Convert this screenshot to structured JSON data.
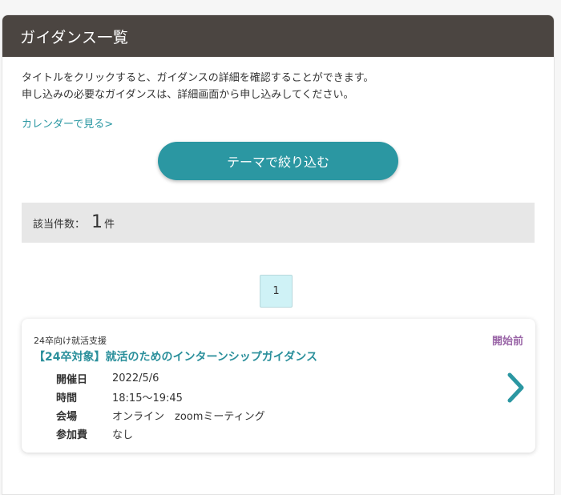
{
  "header": {
    "title": "ガイダンス一覧"
  },
  "description": {
    "line1": "タイトルをクリックすると、ガイダンスの詳細を確認することができます。",
    "line2": "申し込みの必要なガイダンスは、詳細画面から申し込みしてください。"
  },
  "calendar_link": "カレンダーで見る>",
  "theme_button": "テーマで絞り込む",
  "results": {
    "label": "該当件数：",
    "count": "1",
    "unit": "件"
  },
  "pagination": {
    "current_page": "1"
  },
  "guidance": {
    "category": "24卒向け就活支援",
    "status": "開始前",
    "title": "【24卒対象】就活のためのインターンシップガイダンス",
    "rows": [
      {
        "label": "開催日",
        "value": "2022/5/6"
      },
      {
        "label": "時間",
        "value": "18:15〜19:45"
      },
      {
        "label": "会場",
        "value": "オンライン　zoomミーティング"
      },
      {
        "label": "参加費",
        "value": "なし"
      }
    ]
  },
  "colors": {
    "header_bg": "#4b4541",
    "accent": "#2b97a2",
    "status": "#9b67a8",
    "page_active": "#cff2f6"
  },
  "icons": {
    "detail": "chevron-right-icon"
  }
}
